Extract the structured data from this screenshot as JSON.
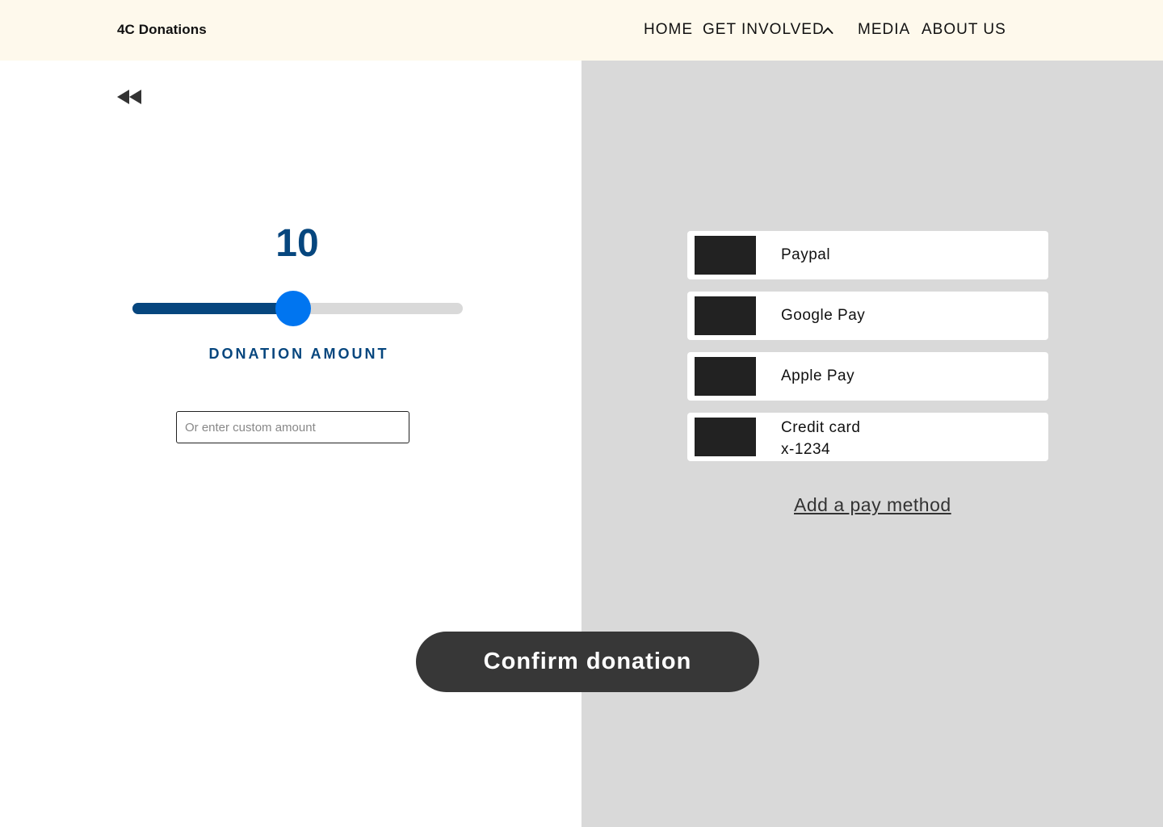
{
  "header": {
    "brand": "4C Donations",
    "nav": {
      "home": "HOME",
      "get_involved": "GET INVOLVED",
      "media": "MEDIA",
      "about": "ABOUT US"
    },
    "expand_icon": "chevron-up-icon"
  },
  "donation": {
    "back_icon": "rewind-icon",
    "amount": "10",
    "slider_fraction": 0.486,
    "label": "DONATION AMOUNT",
    "custom_placeholder": "Or enter custom amount"
  },
  "payment": {
    "methods": [
      {
        "label": "Paypal",
        "sub": ""
      },
      {
        "label": "Google Pay",
        "sub": ""
      },
      {
        "label": "Apple Pay",
        "sub": ""
      },
      {
        "label": "Credit card",
        "sub": "x-1234"
      }
    ],
    "add_link": "Add a pay method"
  },
  "confirm_label": "Confirm donation",
  "colors": {
    "header_bg": "#fef9ec",
    "accent_dark": "#06467e",
    "accent_bright": "#0075f0",
    "panel_gray": "#d9d9d9",
    "button_dark": "#373737"
  }
}
